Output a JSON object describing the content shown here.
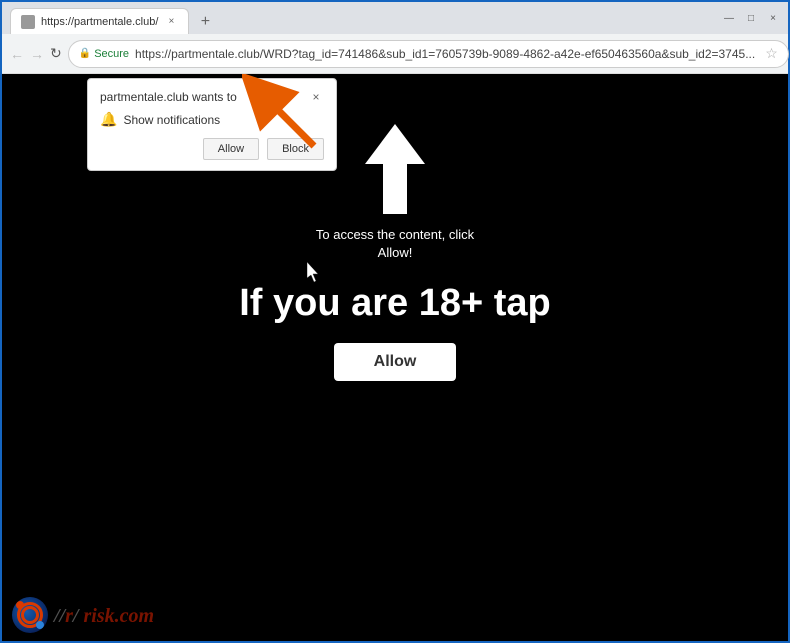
{
  "browser": {
    "tab": {
      "label": "https://partmentale.club/",
      "close_label": "×"
    },
    "window_controls": {
      "minimize": "—",
      "maximize": "□",
      "close": "×"
    },
    "nav": {
      "secure_label": "Secure",
      "address": "https://partmentale.club/WRD?tag_id=741486&sub_id1=7605739b-9089-4862-a42e-ef650463560a&sub_id2=3745...",
      "back_arrow": "←",
      "forward_arrow": "→",
      "refresh": "↻"
    }
  },
  "notification_popup": {
    "title": "partmentale.club wants to",
    "close_btn": "×",
    "notification_text": "Show notifications",
    "allow_btn": "Allow",
    "block_btn": "Block"
  },
  "webpage": {
    "instruction_text": "To access the content, click\nAllow!",
    "big_text": "If you are 18+ tap",
    "allow_btn": "Allow"
  },
  "watermark": {
    "text": "PC",
    "suffix": "risk.com"
  }
}
